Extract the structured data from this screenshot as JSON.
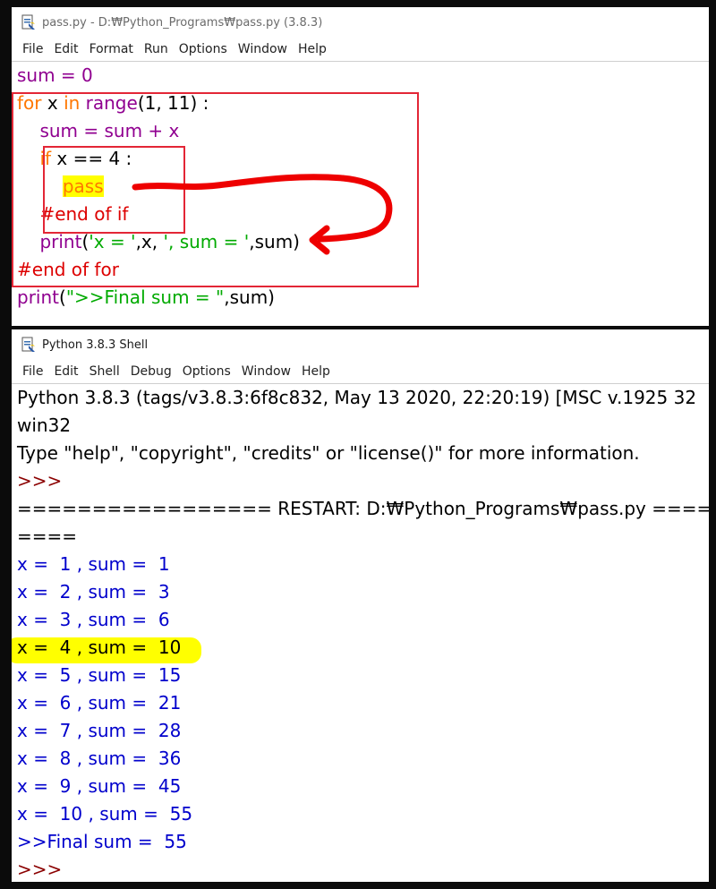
{
  "editor": {
    "title": "pass.py - D:₩Python_Programs₩pass.py (3.8.3)",
    "menu": [
      "File",
      "Edit",
      "Format",
      "Run",
      "Options",
      "Window",
      "Help"
    ],
    "code": {
      "l1": "sum = 0",
      "l2_kw": "for",
      "l2_a": " x ",
      "l2_in": "in",
      "l2_sp": " ",
      "l2_range": "range",
      "l2_b": "(1, 11) :",
      "l3_indent": "    ",
      "l3": "sum = sum + x",
      "l4_indent": "    ",
      "l4_kw": "if",
      "l4_b": " x == 4 :",
      "l5_indent": "        ",
      "l5_kw": "pass",
      "l6_indent": "    ",
      "l6": "#end of if",
      "l7_indent": "    ",
      "l7_print": "print",
      "l7_a": "(",
      "l7_s1": "'x = '",
      "l7_b": ",x, ",
      "l7_s2": "', sum = '",
      "l7_c": ",sum)",
      "l8": "#end of for",
      "l9_print": "print",
      "l9_a": "(",
      "l9_s1": "\">>Final sum = \"",
      "l9_b": ",sum)"
    }
  },
  "shell": {
    "title": "Python 3.8.3 Shell",
    "menu": [
      "File",
      "Edit",
      "Shell",
      "Debug",
      "Options",
      "Window",
      "Help"
    ],
    "banner1": "Python 3.8.3 (tags/v3.8.3:6f8c832, May 13 2020, 22:20:19) [MSC v.1925 32",
    "banner2": "win32",
    "banner3": "Type \"help\", \"copyright\", \"credits\" or \"license()\" for more information.",
    "prompt": ">>>",
    "restart": "================= RESTART: D:₩Python_Programs₩pass.py =====",
    "restart_cont": "====",
    "outputs": [
      "x =  1 , sum =  1",
      "x =  2 , sum =  3",
      "x =  3 , sum =  6",
      "x =  4 , sum =  10",
      "x =  5 , sum =  15",
      "x =  6 , sum =  21",
      "x =  7 , sum =  28",
      "x =  8 , sum =  36",
      "x =  9 , sum =  45",
      "x =  10 , sum =  55"
    ],
    "final": ">>Final sum =  55",
    "prompt_end": ">>>"
  },
  "colors": {
    "keyword": "#ff7700",
    "builtin": "#900090",
    "string": "#00aa00",
    "comment": "#dd0000",
    "output": "#0000cc",
    "annotation_red": "#e32636",
    "highlight": "#ffff00"
  }
}
